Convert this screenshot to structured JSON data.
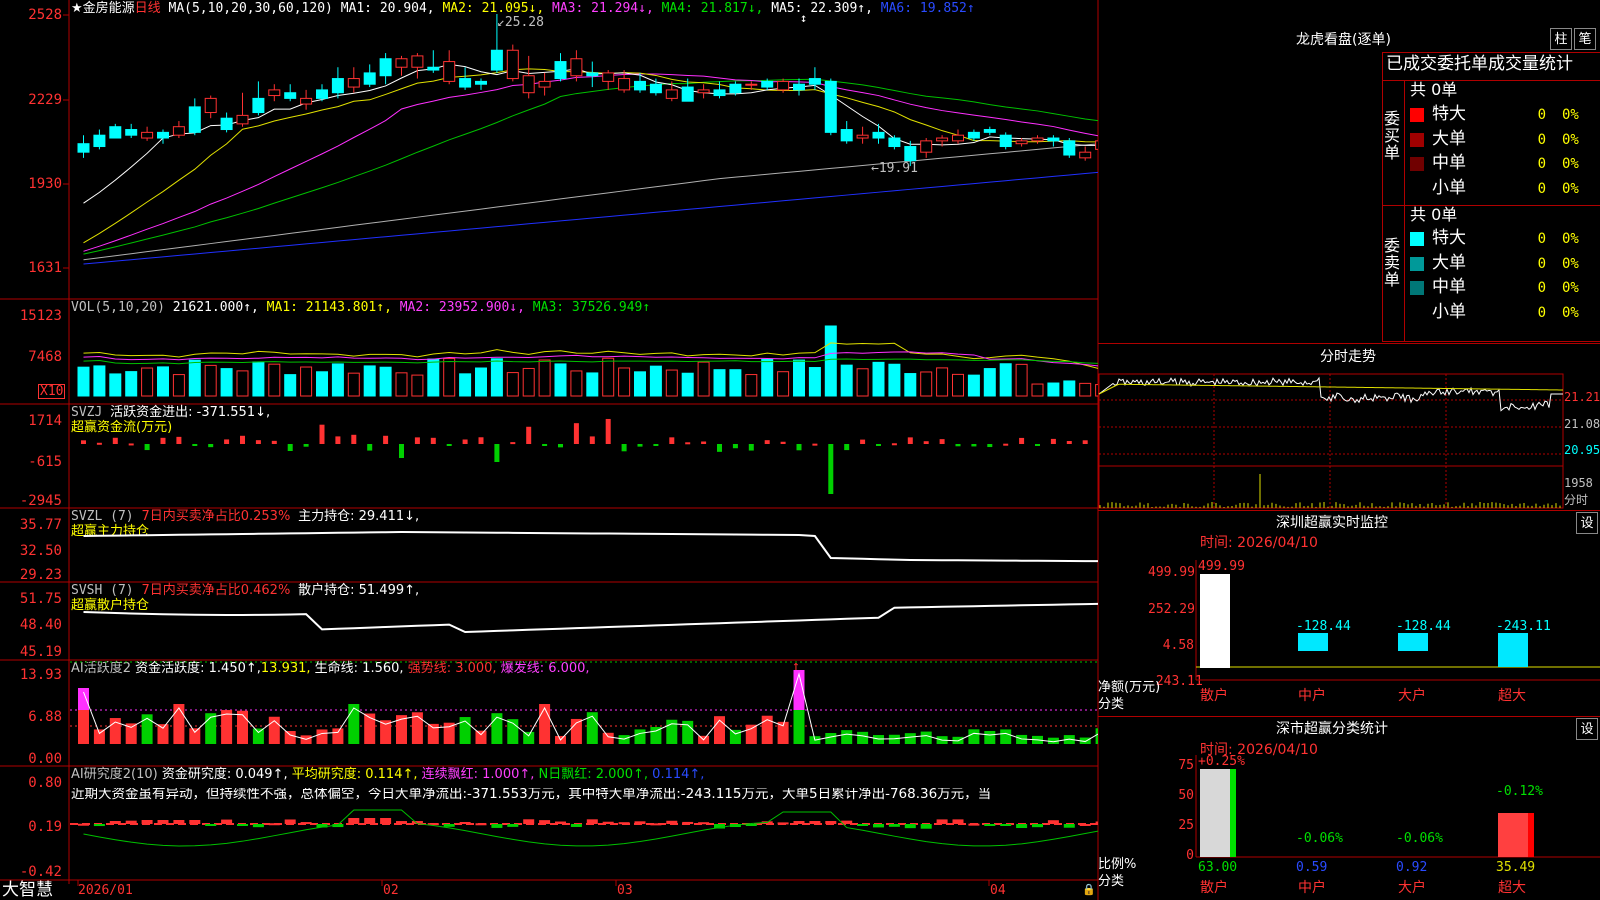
{
  "stock": {
    "name": "★金房能源",
    "period": "日线"
  },
  "price_axis": [
    "2528",
    "2229",
    "1930",
    "1631"
  ],
  "ma_header": {
    "label": "MA(5,10,20,30,60,120)",
    "ma1": "MA1: 20.904,",
    "ma2": "MA2: 21.095↓,",
    "ma3": "MA3: 21.294↓,",
    "ma4": "MA4: 21.817↓,",
    "ma5": "MA5: 22.309↑,",
    "ma6": "MA6: 19.852↑"
  },
  "price_annotations": {
    "high": "25.28",
    "low": "19.91",
    "cursor": "↕"
  },
  "vol_header": {
    "label": "VOL(5,10,20)",
    "v": "21621.000↑,",
    "ma1": "MA1: 21143.801↑,",
    "ma2": "MA2: 23952.900↓,",
    "ma3": "MA3: 37526.949↑"
  },
  "vol_axis": [
    "15123",
    "7468"
  ],
  "vol_unit": "X10",
  "svzj_header": {
    "label": "SVZJ",
    "value": "活跃资金进出: -371.551↓,",
    "sub": "超赢资金流(万元)"
  },
  "svzj_axis": [
    "1714",
    "-615",
    "-2945"
  ],
  "svzl_header": {
    "label": "SVZL (7)",
    "ratio": "7日内买卖净占比0.253%",
    "hold": "主力持仓: 29.411↓,",
    "sub": "超赢主力持仓"
  },
  "svzl_axis": [
    "35.77",
    "32.50",
    "29.23"
  ],
  "svsh_header": {
    "label": "SVSH (7)",
    "ratio": "7日内买卖净占比0.462%",
    "hold": "散户持仓: 51.499↑,",
    "sub": "超赢散户持仓"
  },
  "svsh_axis": [
    "51.75",
    "48.40",
    "45.19"
  ],
  "ai_active": {
    "label": "AI活跃度2",
    "v1": "资金活跃度: 1.450↑,",
    "v2": "13.931,",
    "v3": "生命线: 1.560,",
    "v4": "强势线: 3.000,",
    "v5": "爆发线: 6.000,",
    "mark": "↑"
  },
  "ai_active_axis": [
    "13.93",
    "6.88",
    "0.00"
  ],
  "ai_research": {
    "label": "AI研究度2(10)",
    "v1": "资金研究度: 0.049↑,",
    "v2": "平均研究度: 0.114↑,",
    "v3": "连续飘红: 1.000↑,",
    "v4": "N日飘红: 2.000↑,",
    "v5": "0.114↑,"
  },
  "ai_research_text": "近期大资金虽有异动，但持续性不强，总体偏空，今日大单净流出:-371.553万元，其中特大单净流出:-243.115万元，大单5日累计净出-768.36万元，当",
  "ai_research_axis": [
    "0.80",
    "0.19",
    "-0.42"
  ],
  "date_axis": [
    "2026/01",
    "02",
    "03",
    "04"
  ],
  "brand": "大智慧",
  "right_panel": {
    "title": "龙虎看盘(逐单)",
    "btn1": "柱",
    "btn2": "笔",
    "tabs": "已成交委托单成交量统计",
    "buy_side": "委买单",
    "sell_side": "委卖单",
    "buy_total": "共 0单",
    "sell_total": "共 0单",
    "buy_rows": [
      {
        "name": "特大",
        "count": "0",
        "pct": "0%",
        "color": "#ff0000"
      },
      {
        "name": "大单",
        "count": "0",
        "pct": "0%",
        "color": "#a00000"
      },
      {
        "name": "中单",
        "count": "0",
        "pct": "0%",
        "color": "#700000"
      },
      {
        "name": "小单",
        "count": "0",
        "pct": "0%",
        "color": ""
      }
    ],
    "sell_rows": [
      {
        "name": "特大",
        "count": "0",
        "pct": "0%",
        "color": "#00ffff"
      },
      {
        "name": "大单",
        "count": "0",
        "pct": "0%",
        "color": "#009999"
      },
      {
        "name": "中单",
        "count": "0",
        "pct": "0%",
        "color": "#007777"
      },
      {
        "name": "小单",
        "count": "0",
        "pct": "0%",
        "color": ""
      }
    ],
    "intraday_title": "分时走势",
    "intraday_axis": [
      "21.21",
      "21.08",
      "20.95"
    ],
    "intraday_vol_axis": [
      "1958",
      "分时"
    ],
    "monitor_title": "深圳超赢实时监控",
    "monitor_btn": "设",
    "monitor_time": "时间: 2026/04/10",
    "monitor_axis": [
      "499.99",
      "252.29",
      "4.58",
      "-243.11"
    ],
    "monitor_unit": "净额(万元)",
    "monitor_cat_label": "分类",
    "monitor_bars": [
      {
        "name": "散户",
        "label": "499.99"
      },
      {
        "name": "中户",
        "label": "-128.44"
      },
      {
        "name": "大户",
        "label": "-128.44"
      },
      {
        "name": "超大",
        "label": "-243.11"
      }
    ],
    "stats_title": "深市超赢分类统计",
    "stats_btn": "设",
    "stats_time": "时间: 2026/04/10",
    "stats_axis": [
      "75",
      "50",
      "25",
      "0"
    ],
    "stats_unit": "比例%",
    "stats_cat_label": "分类",
    "stats_bars": [
      {
        "name": "散户",
        "top": "+0.25%",
        "bottom": "63.00"
      },
      {
        "name": "中户",
        "top": "-0.06%",
        "bottom": "0.59"
      },
      {
        "name": "大户",
        "top": "-0.06%",
        "bottom": "0.92"
      },
      {
        "name": "超大",
        "top": "-0.12%",
        "bottom": "35.49"
      }
    ]
  },
  "colors": {
    "up": "#ff3232",
    "down": "#00ffff",
    "frame": "#b00000"
  },
  "chart_data": {
    "type": "candlestick",
    "title": "",
    "ylim": [
      16.31,
      25.28
    ],
    "candles": [
      [
        20.7,
        20.4,
        21.0,
        20.2
      ],
      [
        21.0,
        20.6,
        21.2,
        20.5
      ],
      [
        21.3,
        20.9,
        21.4,
        20.9
      ],
      [
        21.2,
        21.0,
        21.4,
        20.9
      ],
      [
        20.9,
        21.1,
        21.3,
        20.8
      ],
      [
        21.1,
        20.9,
        21.2,
        20.7
      ],
      [
        21.0,
        21.3,
        21.5,
        20.9
      ],
      [
        22.0,
        21.1,
        22.3,
        21.0
      ],
      [
        21.8,
        22.3,
        22.4,
        21.6
      ],
      [
        21.6,
        21.2,
        21.8,
        21.1
      ],
      [
        21.4,
        21.7,
        22.5,
        21.3
      ],
      [
        22.3,
        21.8,
        22.9,
        21.7
      ],
      [
        22.4,
        22.6,
        22.8,
        22.2
      ],
      [
        22.5,
        22.3,
        22.8,
        22.2
      ],
      [
        22.1,
        22.3,
        22.6,
        21.9
      ],
      [
        22.6,
        22.3,
        22.8,
        22.2
      ],
      [
        23.0,
        22.5,
        23.4,
        22.3
      ],
      [
        22.7,
        23.0,
        23.4,
        22.5
      ],
      [
        23.2,
        22.8,
        23.5,
        22.7
      ],
      [
        23.7,
        23.1,
        23.9,
        22.8
      ],
      [
        23.4,
        23.7,
        23.8,
        23.1
      ],
      [
        23.4,
        23.8,
        23.9,
        23.0
      ],
      [
        23.4,
        23.3,
        24.0,
        23.2
      ],
      [
        22.9,
        23.6,
        24.0,
        22.8
      ],
      [
        23.0,
        22.7,
        23.4,
        22.6
      ],
      [
        22.9,
        22.8,
        23.0,
        22.6
      ],
      [
        24.0,
        23.3,
        25.28,
        23.2
      ],
      [
        23.0,
        24.0,
        24.2,
        22.9
      ],
      [
        22.5,
        23.1,
        23.8,
        22.3
      ],
      [
        22.7,
        22.9,
        23.2,
        22.4
      ],
      [
        23.6,
        23.0,
        23.9,
        22.9
      ],
      [
        23.1,
        23.7,
        24.0,
        22.9
      ],
      [
        23.2,
        23.1,
        23.6,
        22.7
      ],
      [
        22.9,
        23.2,
        23.3,
        22.6
      ],
      [
        22.6,
        23.0,
        23.3,
        22.5
      ],
      [
        22.9,
        22.6,
        23.2,
        22.5
      ],
      [
        22.8,
        22.5,
        23.0,
        22.4
      ],
      [
        22.3,
        22.6,
        22.9,
        22.2
      ],
      [
        22.7,
        22.2,
        23.0,
        22.2
      ],
      [
        22.5,
        22.6,
        22.8,
        22.3
      ],
      [
        22.6,
        22.4,
        22.9,
        22.3
      ],
      [
        22.8,
        22.5,
        22.9,
        22.4
      ],
      [
        22.8,
        22.8,
        22.9,
        22.6
      ],
      [
        22.9,
        22.7,
        23.0,
        22.6
      ],
      [
        22.6,
        22.9,
        23.0,
        22.5
      ],
      [
        22.8,
        22.6,
        23.0,
        22.4
      ],
      [
        23.0,
        22.8,
        23.4,
        22.6
      ],
      [
        22.9,
        21.1,
        23.0,
        21.0
      ],
      [
        21.2,
        20.8,
        21.5,
        20.7
      ],
      [
        20.9,
        21.0,
        21.3,
        20.7
      ],
      [
        21.1,
        20.9,
        21.4,
        20.7
      ],
      [
        20.9,
        20.6,
        21.0,
        20.5
      ],
      [
        20.6,
        20.1,
        20.8,
        19.91
      ],
      [
        20.4,
        20.8,
        20.9,
        20.2
      ],
      [
        20.8,
        20.9,
        21.0,
        20.6
      ],
      [
        20.8,
        21.0,
        21.2,
        20.7
      ],
      [
        21.1,
        20.9,
        21.2,
        20.8
      ],
      [
        21.2,
        21.1,
        21.3,
        21.0
      ],
      [
        21.0,
        20.6,
        21.1,
        20.5
      ],
      [
        20.7,
        20.8,
        20.9,
        20.6
      ],
      [
        20.8,
        20.9,
        21.0,
        20.7
      ],
      [
        20.9,
        20.8,
        21.0,
        20.6
      ],
      [
        20.8,
        20.3,
        20.9,
        20.2
      ],
      [
        20.2,
        20.4,
        20.6,
        20.1
      ],
      [
        20.5,
        20.8,
        20.9,
        20.4
      ],
      [
        20.8,
        20.9,
        21.0,
        20.7
      ],
      [
        20.9,
        20.8,
        21.0,
        20.7
      ],
      [
        20.8,
        20.9,
        21.0,
        20.7
      ]
    ],
    "date_ticks": [
      "2026/01",
      "02",
      "03",
      "04"
    ]
  }
}
